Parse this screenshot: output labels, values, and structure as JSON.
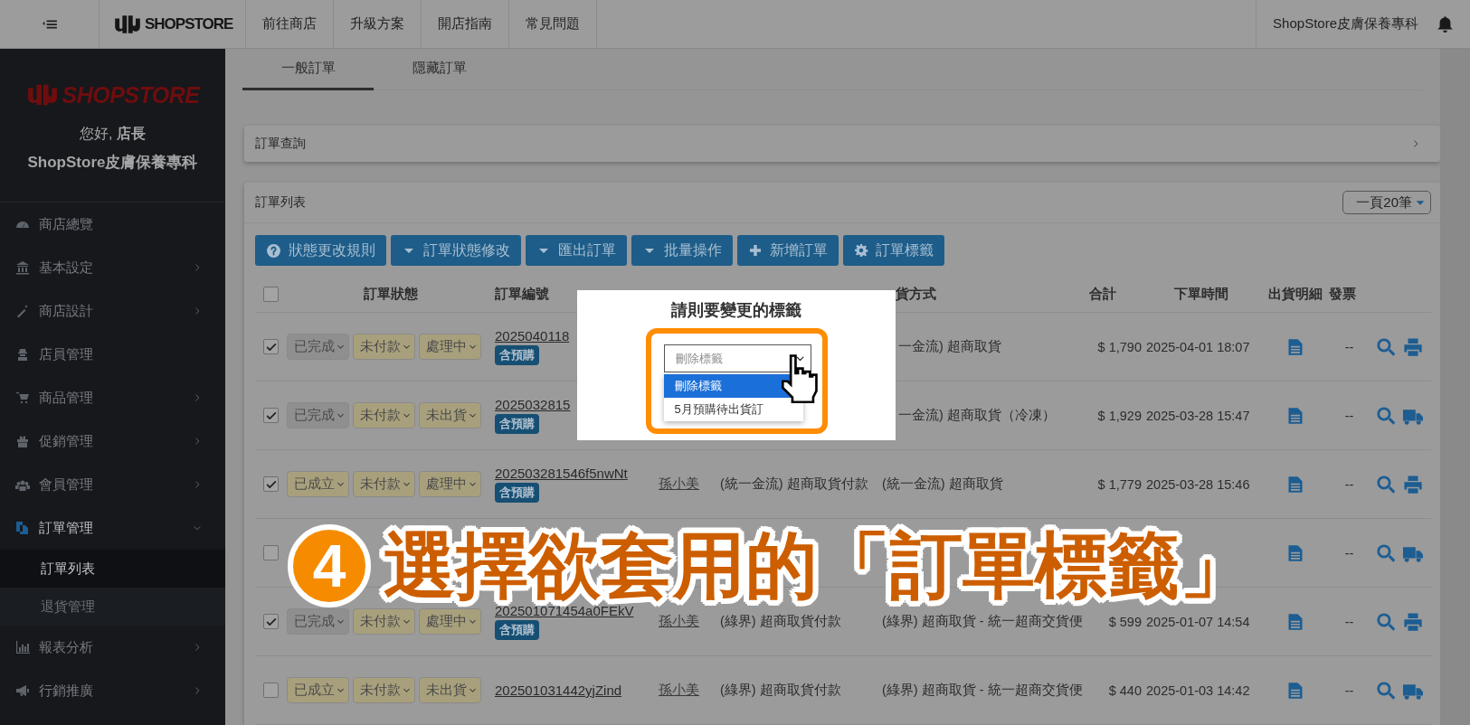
{
  "topbar": {
    "logo": "SHOPSTORE",
    "nav": [
      "前往商店",
      "升級方案",
      "開店指南",
      "常見問題"
    ],
    "shop_name": "ShopStore皮膚保養專科"
  },
  "sidebar": {
    "logo": "SHOPSTORE",
    "greeting": "您好, **店長**",
    "shop_name": "ShopStore皮膚保養專科",
    "items": [
      {
        "label": "商店總覽",
        "kind": "link",
        "selected": false
      },
      {
        "label": "基本設定",
        "kind": "group",
        "expanded": false,
        "selected": false
      },
      {
        "label": "商店設計",
        "kind": "group",
        "expanded": false,
        "selected": false
      },
      {
        "label": "店員管理",
        "kind": "link",
        "selected": false
      },
      {
        "label": "商品管理",
        "kind": "group",
        "expanded": false,
        "selected": false
      },
      {
        "label": "促銷管理",
        "kind": "group",
        "expanded": false,
        "selected": false
      },
      {
        "label": "會員管理",
        "kind": "group",
        "expanded": false,
        "selected": false
      },
      {
        "label": "訂單管理",
        "kind": "group",
        "expanded": true,
        "selected": true,
        "children": [
          {
            "label": "訂單列表",
            "selected": true
          },
          {
            "label": "退貨管理",
            "selected": false
          }
        ]
      },
      {
        "label": "報表分析",
        "kind": "group",
        "expanded": false,
        "selected": false
      },
      {
        "label": "行銷推廣",
        "kind": "group",
        "expanded": false,
        "selected": false
      }
    ]
  },
  "tabs": [
    {
      "label": "一般訂單",
      "selected": true
    },
    {
      "label": "隱藏訂單",
      "selected": false
    }
  ],
  "order_search": {
    "title": "訂單查詢",
    "expanded": false
  },
  "order_list": {
    "title": "訂單列表",
    "page_size": "一頁20筆",
    "toolbar": [
      {
        "label": "狀態更改規則",
        "kind": "help"
      },
      {
        "label": "訂單狀態修改",
        "kind": "dropdown"
      },
      {
        "label": "匯出訂單",
        "kind": "dropdown"
      },
      {
        "label": "批量操作",
        "kind": "dropdown"
      },
      {
        "label": "新增訂單",
        "kind": "add"
      },
      {
        "label": "訂單標籤",
        "kind": "settings"
      }
    ],
    "select_all": {
      "checked": false
    },
    "columns": {
      "status": "訂單狀態",
      "order_no": "訂單編號",
      "shipping": "貨方式",
      "total": "合計",
      "time": "下單時間",
      "shipping_detail": "出貨明細",
      "invoice": "發票"
    },
    "rows": [
      {
        "checked": true,
        "statuses": [
          {
            "label": "已完成",
            "color": "#8f8f8f"
          },
          {
            "label": "未付款",
            "color": "#a8a07c"
          },
          {
            "label": "處理中",
            "color": "#a8a07c"
          }
        ],
        "order_no": "2025040118",
        "tag": "含預購",
        "shipping": "一金流) 超商取貨",
        "total": "$ 1,790",
        "time": "2025-04-01 18:07",
        "invoice": "--",
        "kind": "print"
      },
      {
        "checked": true,
        "statuses": [
          {
            "label": "已完成",
            "color": "#8f8f8f"
          },
          {
            "label": "未付款",
            "color": "#a8a07c"
          },
          {
            "label": "未出貨",
            "color": "#a8a07c"
          }
        ],
        "order_no": "2025032815",
        "tag": "含預購",
        "shipping": "一金流) 超商取貨（冷凍）",
        "total": "$ 1,929",
        "time": "2025-03-28 15:47",
        "invoice": "--",
        "kind": "truck"
      },
      {
        "checked": true,
        "statuses": [
          {
            "label": "已成立",
            "color": "#a8a07c"
          },
          {
            "label": "未付款",
            "color": "#a8a07c"
          },
          {
            "label": "處理中",
            "color": "#a8a07c"
          }
        ],
        "order_no": "202503281546f5nwNt",
        "tag": "含預購",
        "customer": "孫小美",
        "payment": "(統一金流) 超商取貨付款",
        "shipping": "(統一金流) 超商取貨",
        "total": "$ 1,779",
        "time": "2025-03-28 15:46",
        "invoice": "--",
        "kind": "print"
      },
      {
        "checked": false,
        "invoice": "--",
        "kind": "truck"
      },
      {
        "checked": true,
        "statuses": [
          {
            "label": "已完成",
            "color": "#8f8f8f"
          },
          {
            "label": "未付款",
            "color": "#a8a07c"
          },
          {
            "label": "處理中",
            "color": "#a8a07c"
          }
        ],
        "order_no": "202501071454a0FEkV",
        "tag": "含預購",
        "customer": "孫小美",
        "payment": "(綠界) 超商取貨付款",
        "shipping": "(綠界) 超商取貨 - 統一超商交貨便",
        "total": "$ 599",
        "time": "2025-01-07 14:54",
        "invoice": "--",
        "kind": "print"
      },
      {
        "checked": false,
        "statuses": [
          {
            "label": "已成立",
            "color": "#a8a07c"
          },
          {
            "label": "未付款",
            "color": "#a8a07c"
          },
          {
            "label": "未出貨",
            "color": "#a8a07c"
          }
        ],
        "order_no": "202501031442yjZind",
        "customer": "孫小美",
        "payment": "(綠界) 超商取貨付款",
        "shipping": "(綠界) 超商取貨 - 統一超商交貨便",
        "total": "$ 440",
        "time": "2025-01-03 14:42",
        "invoice": "--",
        "kind": "truck"
      }
    ]
  },
  "modal": {
    "title": "請則要變更的標籤",
    "value": "刪除標籤",
    "options": [
      {
        "label": "刪除標籤",
        "selected": true
      },
      {
        "label": "5月預購待出貨訂",
        "selected": false
      }
    ]
  },
  "annotation": {
    "number": "4",
    "text": "選擇欲套用的「訂單標籤」"
  }
}
